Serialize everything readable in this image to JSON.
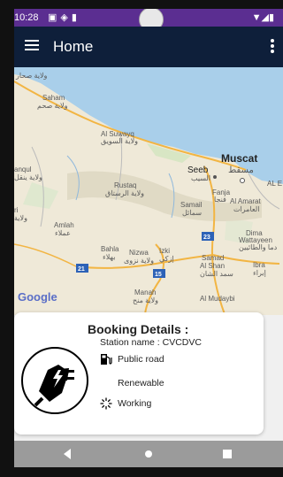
{
  "status_bar": {
    "time": "10:28",
    "left_icons": [
      "notification-icon",
      "shield-icon",
      "sd-card-icon"
    ],
    "right_icons": [
      "wifi-icon",
      "signal-icon",
      "battery-icon"
    ]
  },
  "app_bar": {
    "title": "Home",
    "menu_icon": "hamburger-menu-icon",
    "overflow_icon": "more-vert-icon"
  },
  "map": {
    "labels": {
      "sohar_ar": "ولاية صحار",
      "saham": "Saham",
      "saham_ar": "ولاية صحم",
      "al_suwayq": "Al Suwayq",
      "al_suwayq_ar": "ولاية السويق",
      "muscat": "Muscat",
      "muscat_ar": "مسقط",
      "seeb": "Seeb",
      "seeb_ar": "السيب",
      "anqul": "anqul",
      "anqul_ar": "ولاية ينقل",
      "rustaq": "Rustaq",
      "rustaq_ar": "ولاية الرستاق",
      "fanja": "Fanja",
      "fanja_ar": "فنجا",
      "al_amarat": "Al Amarat",
      "al_amarat_ar": "العامرات",
      "samail": "Samail",
      "samail_ar": "سمائل",
      "alef": "AL E",
      "ri": "ri",
      "ri_ar": "ولاية",
      "amlah": "Amlah",
      "amlah_ar": "عملاء",
      "dima": "Dima",
      "wattayeen": "Wattayeen",
      "wattayeen_ar": "دما والطائيين",
      "bahla": "Bahla",
      "bahla_ar": "بهلاء",
      "nizwa": "Nizwa",
      "nizwa_ar": "ولاية نزوى",
      "izki": "Izki",
      "izki_ar": "إزكي",
      "samad": "Samad",
      "al_shan": "Al Shan",
      "al_shan_ar": "سمد الشان",
      "ibra": "Ibra",
      "ibra_ar": "إبراء",
      "manah": "Manah",
      "manah_ar": "ولاية منح",
      "al_mudaybi": "Al Mudaybi",
      "route_21": "21",
      "route_15": "15",
      "route_23": "23",
      "google": "Google"
    }
  },
  "booking": {
    "heading": "Booking Details :",
    "station_label": "Station name :",
    "station_value": "CVCDVC",
    "location_type": "Public road",
    "energy_type": "Renewable",
    "status": "Working",
    "icons": {
      "charger": "ev-charger-plug-icon",
      "location": "fuel-pump-icon",
      "status": "loading-spinner-icon"
    }
  },
  "nav_bar": {
    "back_icon": "back-triangle-icon",
    "home_icon": "home-circle-icon",
    "recent_icon": "recent-square-icon"
  },
  "colors": {
    "status_bar": "#5b2e91",
    "app_bar": "#0e1f3a",
    "sea": "#a9cfea",
    "land": "#efe9d8",
    "nav_bar": "#9b9b9b"
  }
}
